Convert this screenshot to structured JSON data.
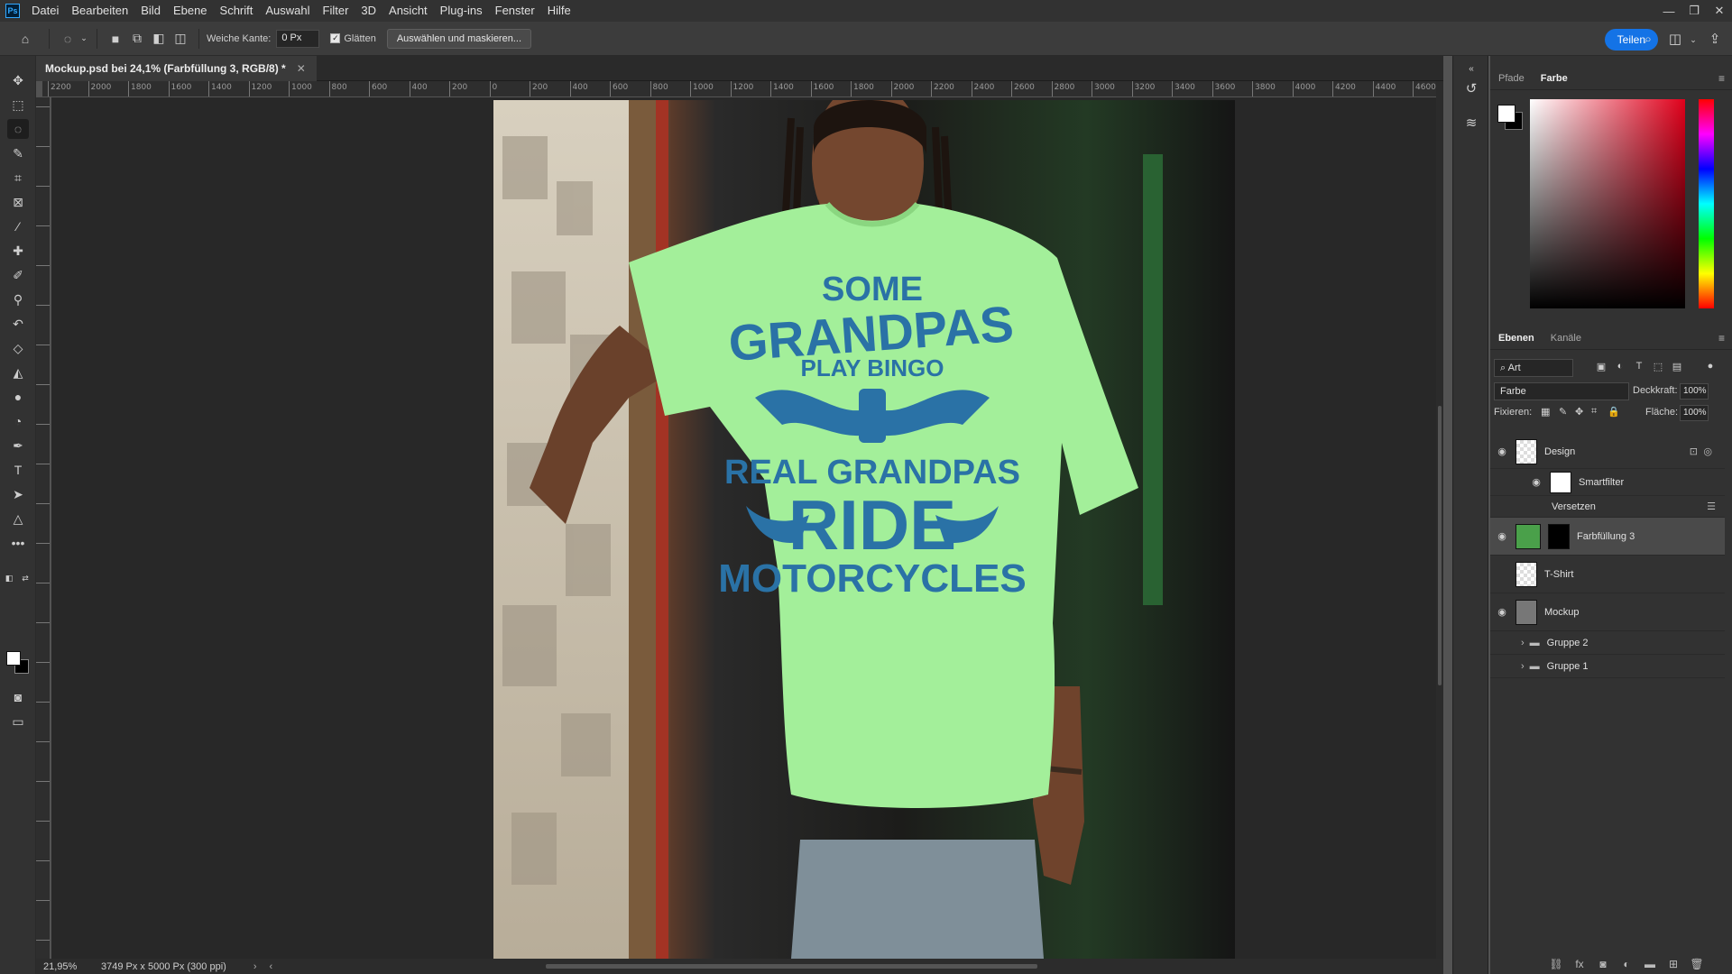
{
  "menu": [
    "Datei",
    "Bearbeiten",
    "Bild",
    "Ebene",
    "Schrift",
    "Auswahl",
    "Filter",
    "3D",
    "Ansicht",
    "Plug-ins",
    "Fenster",
    "Hilfe"
  ],
  "app_logo": "Ps",
  "options": {
    "feather_label": "Weiche Kante:",
    "feather_value": "0 Px",
    "antialias_label": "Glätten",
    "antialias_checked": true,
    "select_mask_label": "Auswählen und maskieren..."
  },
  "share_label": "Teilen",
  "document": {
    "tab_title": "Mockup.psd bei 24,1% (Farbfüllung 3, RGB/8) *",
    "zoom": "21,95%",
    "doc_info": "3749 Px x 5000 Px (300 ppi)"
  },
  "rulers": {
    "horizontal": [
      "2200",
      "2000",
      "1800",
      "1600",
      "1400",
      "1200",
      "1000",
      "800",
      "600",
      "400",
      "200",
      "0",
      "200",
      "400",
      "600",
      "800",
      "1000",
      "1200",
      "1400",
      "1600",
      "1800",
      "2000",
      "2200",
      "2400",
      "2600",
      "2800",
      "3000",
      "3200",
      "3400",
      "3600",
      "3800",
      "4000",
      "4200",
      "4400",
      "4600"
    ]
  },
  "artwork": {
    "line1": "SOME",
    "line2": "GRANDPAS",
    "line3": "PLAY BINGO",
    "line4": "REAL GRANDPAS",
    "line5": "RIDE",
    "line6": "MOTORCYCLES",
    "shirt_color": "#a3ef9a",
    "print_color": "#2a72a6"
  },
  "color_panel": {
    "tabs": [
      "Pfade",
      "Farbe"
    ],
    "active_tab": "Farbe",
    "foreground": "#ffffff",
    "background": "#000000",
    "hue_color": "#e0001b"
  },
  "layers_panel": {
    "tabs": [
      "Ebenen",
      "Kanäle"
    ],
    "active_tab": "Ebenen",
    "filter_kind": "Art",
    "blend_mode": "Farbe",
    "opacity_label": "Deckkraft:",
    "opacity_value": "100%",
    "lock_label": "Fixieren:",
    "fill_label": "Fläche:",
    "fill_value": "100%",
    "layers": [
      {
        "name": "Design",
        "visible": true
      },
      {
        "name": "Smartfilter",
        "visible": true
      },
      {
        "name": "Versetzen",
        "visible": true
      },
      {
        "name": "Farbfüllung 3",
        "visible": true,
        "selected": true
      },
      {
        "name": "T-Shirt",
        "visible": false
      },
      {
        "name": "Mockup",
        "visible": true
      },
      {
        "name": "Gruppe 2",
        "visible": false
      },
      {
        "name": "Gruppe 1",
        "visible": false
      }
    ]
  }
}
